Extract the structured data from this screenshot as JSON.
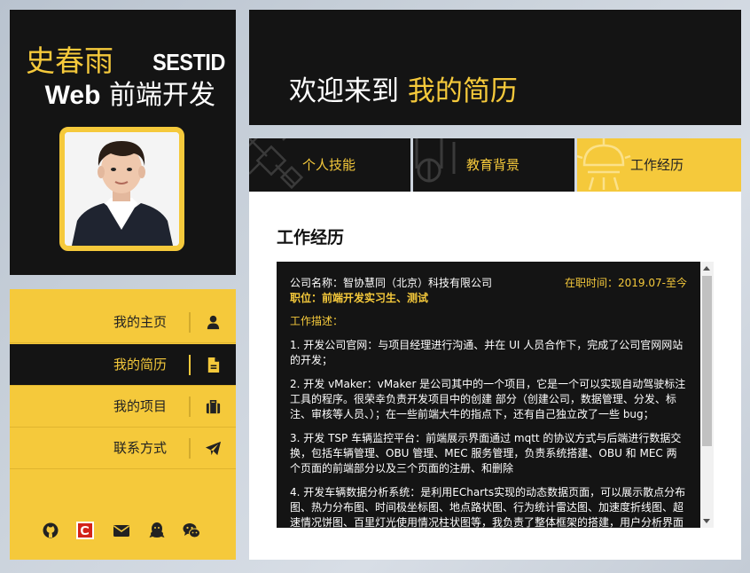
{
  "profile": {
    "name": "史春雨",
    "handle": "SESTID",
    "role_en": "Web",
    "role_zh": " 前端开发"
  },
  "nav": {
    "items": [
      {
        "label": "我的主页",
        "icon": "user-icon"
      },
      {
        "label": "我的简历",
        "icon": "document-icon"
      },
      {
        "label": "我的项目",
        "icon": "briefcase-icon"
      },
      {
        "label": "联系方式",
        "icon": "paper-plane-icon"
      }
    ],
    "socials": [
      "github-icon",
      "csdn-icon",
      "mail-icon",
      "qq-icon",
      "wechat-icon"
    ]
  },
  "header": {
    "welcome_prefix": "欢迎来到 ",
    "welcome_highlight": "我的简历"
  },
  "tabs": [
    {
      "label": "个人技能",
      "bg_icon": "satellite-icon"
    },
    {
      "label": "教育背景",
      "bg_icon": "graduation-icon"
    },
    {
      "label": "工作经历",
      "bg_icon": "lamp-icon"
    }
  ],
  "content": {
    "heading": "工作经历",
    "company": "公司名称：智协慧同（北京）科技有限公司",
    "period": "在职时间：2019.07-至今",
    "job": "职位：前端开发实习生、测试",
    "desc_title": "工作描述：",
    "items": [
      "1. 开发公司官网：与项目经理进行沟通、并在 UI 人员合作下，完成了公司官网网站的开发；",
      "2. 开发 vMaker：vMaker 是公司其中的一个项目，它是一个可以实现自动驾驶标注工具的程序。很荣幸负责开发项目中的创建 部分（创建公司，数据管理、分发、标注、审核等人员、）；在一些前端大牛的指点下，还有自己独立改了一些 bug；",
      "3. 开发 TSP 车辆监控平台：前端展示界面通过 mqtt 的协议方式与后端进行数据交换，包括车辆管理、OBU 管理、MEC 服务管理，负责系统搭建、OBU 和 MEC 两个页面的前端部分以及三个页面的注册、和删除",
      "4. 开发车辆数据分析系统：是利用ECharts实现的动态数据页面，可以展示散点分布图、热力分布图、时间极坐标图、地点路状图、行为统计雷达图、加速度折线图、超速情况饼图、百里灯光使用情况柱状图等，我负责了整体框架的搭建，用户分析界面"
    ]
  },
  "colors": {
    "accent": "#f5c93b",
    "dark": "#141414"
  }
}
